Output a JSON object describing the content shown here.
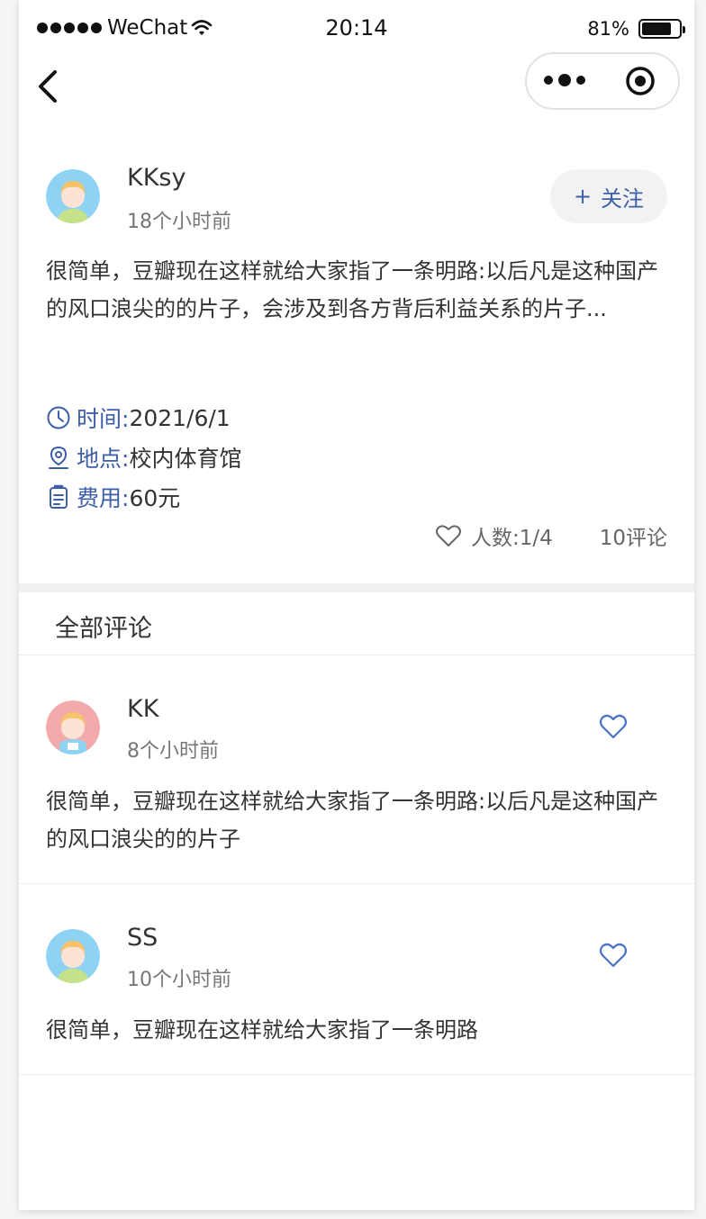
{
  "status_bar": {
    "carrier": "WeChat",
    "time": "20:14",
    "battery_percent": "81%",
    "battery_level": 0.81
  },
  "nav": {
    "back_icon": "chevron-left-icon",
    "more_icon": "more-dots-icon",
    "close_icon": "target-circle-icon"
  },
  "post": {
    "author": "KKsy",
    "time": "18个小时前",
    "follow_label": "关注",
    "follow_prefix": "+",
    "content": "很简单，豆瓣现在这样就给大家指了一条明路:以后凡是这种国产的风口浪尖的的片子，会涉及到各方背后利益关系的片子...",
    "info": {
      "time_label": "时间:",
      "time_value": "2021/6/1",
      "place_label": "地点:",
      "place_value": "校内体育馆",
      "fee_label": "费用:",
      "fee_value": "60元"
    },
    "people_label": "人数:1/4",
    "comments_count": "10评论"
  },
  "comments_section": {
    "title": "全部评论",
    "items": [
      {
        "author": "KK",
        "time": "8个小时前",
        "text": "很简单，豆瓣现在这样就给大家指了一条明路:以后凡是这种国产的风口浪尖的的片子",
        "avatar": "girl-avatar-pink"
      },
      {
        "author": "SS",
        "time": "10个小时前",
        "text": "很简单，豆瓣现在这样就给大家指了一条明路",
        "avatar": "girl-avatar-blue"
      }
    ]
  },
  "colors": {
    "accent": "#3d5ea8",
    "heart": "#4a73c4",
    "text": "#333333",
    "muted": "#777777"
  }
}
